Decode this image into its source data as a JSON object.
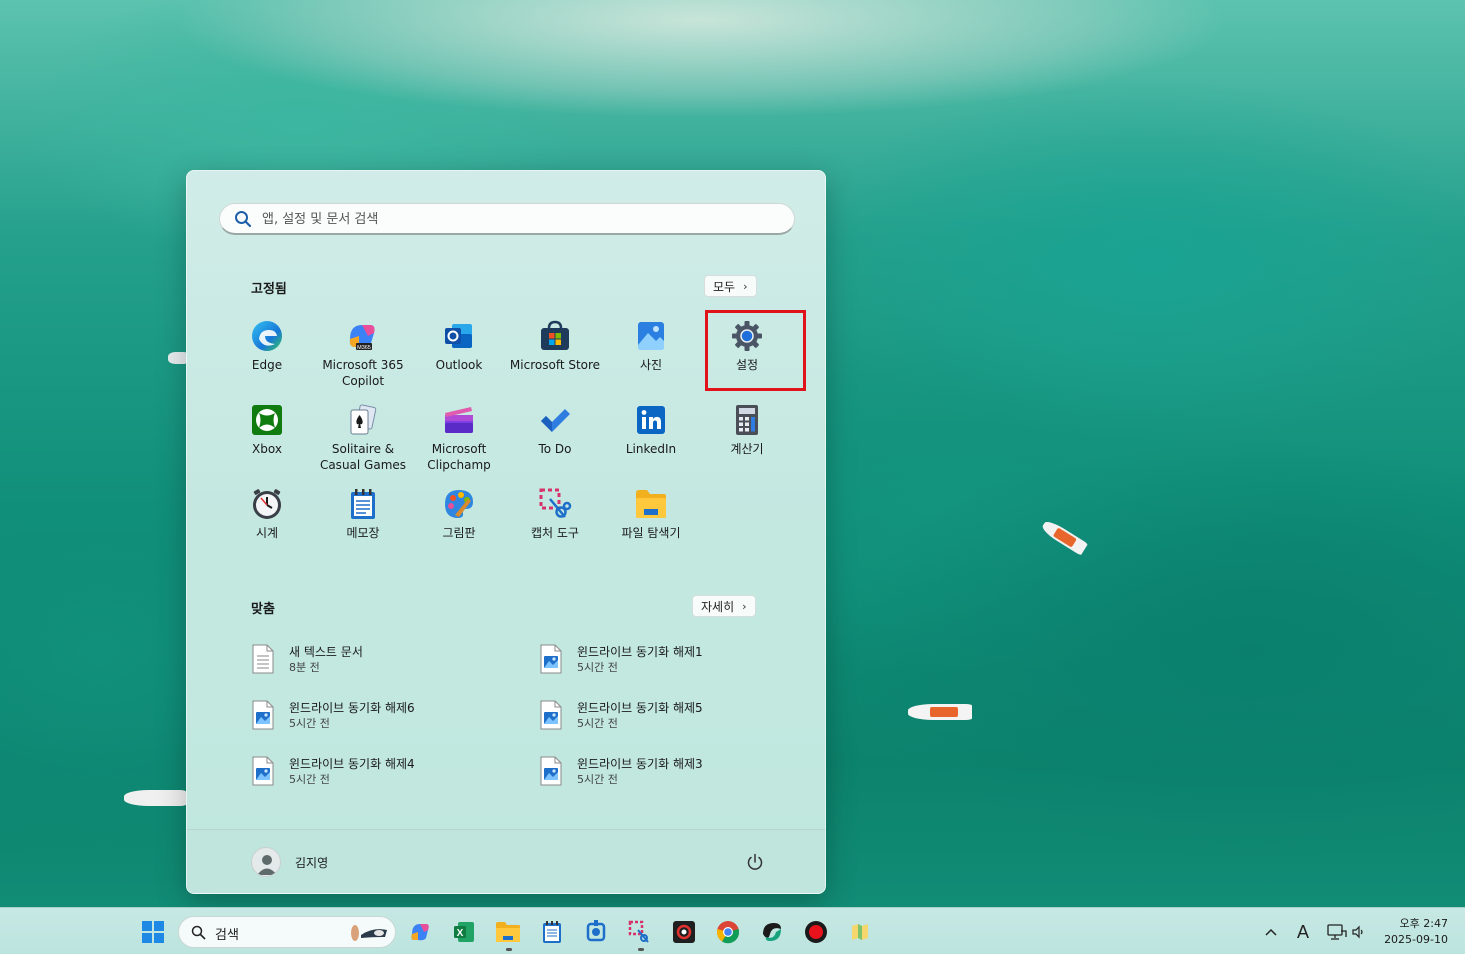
{
  "start_menu": {
    "search_placeholder": "앱, 설정 및 문서 검색",
    "pinned": {
      "title": "고정됨",
      "all_button": "모두",
      "apps": [
        {
          "label": "Edge",
          "icon": "edge-icon"
        },
        {
          "label": "Microsoft 365\nCopilot",
          "icon": "m365-copilot-icon"
        },
        {
          "label": "Outlook",
          "icon": "outlook-icon"
        },
        {
          "label": "Microsoft Store",
          "icon": "store-icon"
        },
        {
          "label": "사진",
          "icon": "photos-icon"
        },
        {
          "label": "설정",
          "icon": "gear-icon"
        },
        {
          "label": "Xbox",
          "icon": "xbox-icon"
        },
        {
          "label": "Solitaire &\nCasual Games",
          "icon": "solitaire-icon"
        },
        {
          "label": "Microsoft\nClipchamp",
          "icon": "clipchamp-icon"
        },
        {
          "label": "To Do",
          "icon": "todo-icon"
        },
        {
          "label": "LinkedIn",
          "icon": "linkedin-icon"
        },
        {
          "label": "계산기",
          "icon": "calculator-icon"
        },
        {
          "label": "시계",
          "icon": "clock-icon"
        },
        {
          "label": "메모장",
          "icon": "notepad-icon"
        },
        {
          "label": "그림판",
          "icon": "paint-icon"
        },
        {
          "label": "캡처 도구",
          "icon": "snipping-tool-icon"
        },
        {
          "label": "파일 탐색기",
          "icon": "file-explorer-icon"
        }
      ]
    },
    "recommended": {
      "title": "맞춤",
      "more_button": "자세히",
      "items": [
        {
          "name": "새 텍스트 문서",
          "time": "8분 전",
          "type": "text"
        },
        {
          "name": "윈드라이브 동기화 해제1",
          "time": "5시간 전",
          "type": "image"
        },
        {
          "name": "윈드라이브 동기화 해제6",
          "time": "5시간 전",
          "type": "image"
        },
        {
          "name": "윈드라이브 동기화 해제5",
          "time": "5시간 전",
          "type": "image"
        },
        {
          "name": "윈드라이브 동기화 해제4",
          "time": "5시간 전",
          "type": "image"
        },
        {
          "name": "윈드라이브 동기화 해제3",
          "time": "5시간 전",
          "type": "image"
        }
      ]
    },
    "user": {
      "name": "김지영"
    }
  },
  "taskbar": {
    "search_label": "검색",
    "tray": {
      "ime": "A",
      "time": "오후 2:47",
      "date": "2025-09-10"
    }
  },
  "colors": {
    "highlight": "#e0131b",
    "menu_bg": "#c3e8e0",
    "taskbar_bg": "#c7e8e4"
  }
}
